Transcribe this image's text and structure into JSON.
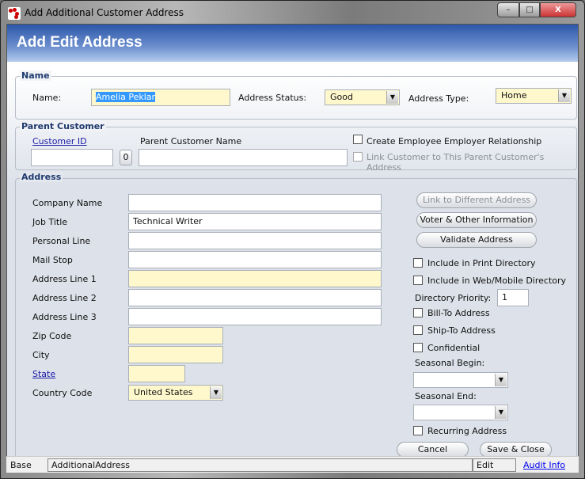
{
  "window": {
    "title": "Add Additional Customer Address",
    "min": "–",
    "max": "□",
    "close": "X"
  },
  "header": {
    "title": "Add Edit Address"
  },
  "name_group": {
    "legend": "Name",
    "name_label": "Name:",
    "name_value": "Amelia Peklar",
    "status_label": "Address Status:",
    "status_value": "Good",
    "type_label": "Address Type:",
    "type_value": "Home"
  },
  "parent_group": {
    "legend": "Parent Customer",
    "customer_id_label": "Customer ID",
    "zero_button": "0",
    "parent_name_label": "Parent Customer Name",
    "create_rel_label": "Create Employee Employer Relationship",
    "link_label": "Link Customer to This Parent Customer's Address"
  },
  "address_group": {
    "legend": "Address",
    "fields": [
      {
        "label": "Company Name",
        "value": ""
      },
      {
        "label": "Job Title",
        "value": "Technical Writer"
      },
      {
        "label": "Personal Line",
        "value": ""
      },
      {
        "label": "Mail Stop",
        "value": ""
      },
      {
        "label": "Address Line 1",
        "value": ""
      },
      {
        "label": "Address Line 2",
        "value": ""
      },
      {
        "label": "Address Line 3",
        "value": ""
      },
      {
        "label": "Zip Code",
        "value": ""
      },
      {
        "label": "City",
        "value": ""
      },
      {
        "label": "State",
        "value": ""
      },
      {
        "label": "Country Code",
        "value": "United States"
      }
    ],
    "link_button": "Link to Different Address",
    "voter_button": "Voter & Other Information",
    "validate_button": "Validate Address",
    "print_dir": "Include in Print Directory",
    "web_dir": "Include in Web/Mobile Directory",
    "priority_label": "Directory Priority:",
    "priority_value": "1",
    "bill_to": "Bill-To Address",
    "ship_to": "Ship-To Address",
    "confidential": "Confidential",
    "seasonal_begin": "Seasonal Begin:",
    "seasonal_end": "Seasonal End:",
    "recurring": "Recurring Address",
    "cancel": "Cancel",
    "save_close": "Save & Close"
  },
  "status_bar": {
    "base": "Base",
    "entity": "AdditionalAddress",
    "mode": "Edit",
    "audit": "Audit Info"
  }
}
